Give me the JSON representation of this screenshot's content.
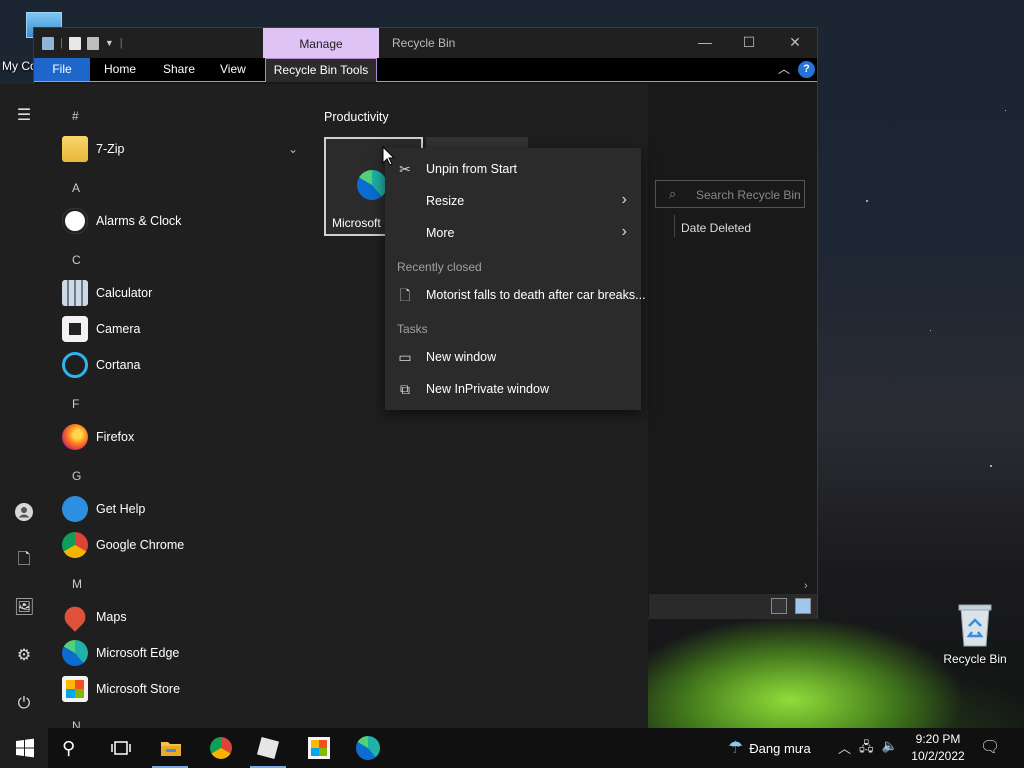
{
  "desktop": {
    "this_pc_label": "My Co",
    "recycle_bin_label": "Recycle Bin"
  },
  "explorer": {
    "title": "Recycle Bin",
    "manage_tab": "Manage",
    "ribbon_tabs": [
      "File",
      "Home",
      "Share",
      "View"
    ],
    "context_tab": "Recycle Bin Tools",
    "search_placeholder": "Search Recycle Bin",
    "column_date_deleted": "Date Deleted",
    "help": "?"
  },
  "start_menu": {
    "sections": [
      "#",
      "A",
      "C",
      "F",
      "G",
      "M",
      "N"
    ],
    "apps": [
      {
        "name": "7-Zip",
        "icon": "folder-icon"
      },
      {
        "name": "Alarms & Clock",
        "icon": "alarm-clock-icon"
      },
      {
        "name": "Calculator",
        "icon": "calculator-icon"
      },
      {
        "name": "Camera",
        "icon": "camera-icon"
      },
      {
        "name": "Cortana",
        "icon": "cortana-icon"
      },
      {
        "name": "Firefox",
        "icon": "firefox-icon"
      },
      {
        "name": "Get Help",
        "icon": "get-help-icon"
      },
      {
        "name": "Google Chrome",
        "icon": "chrome-icon"
      },
      {
        "name": "Maps",
        "icon": "maps-icon"
      },
      {
        "name": "Microsoft Edge",
        "icon": "edge-icon"
      },
      {
        "name": "Microsoft Store",
        "icon": "store-icon"
      }
    ],
    "group_label": "Productivity",
    "tile_label": "Microsoft"
  },
  "context_menu": {
    "unpin": "Unpin from Start",
    "resize": "Resize",
    "more": "More",
    "recent_header": "Recently closed",
    "recent_item": "Motorist falls to death after car breaks...",
    "tasks_header": "Tasks",
    "new_window": "New window",
    "new_private": "New InPrivate window"
  },
  "taskbar": {
    "weather_text": "Đang mưa",
    "time": "9:20 PM",
    "date": "10/2/2022"
  },
  "colors": {
    "accent_blue": "#1e66c9",
    "manage_tab": "#dfc3f4",
    "start_bg": "#1f1f1f",
    "menu_bg": "#2b2b2b"
  }
}
